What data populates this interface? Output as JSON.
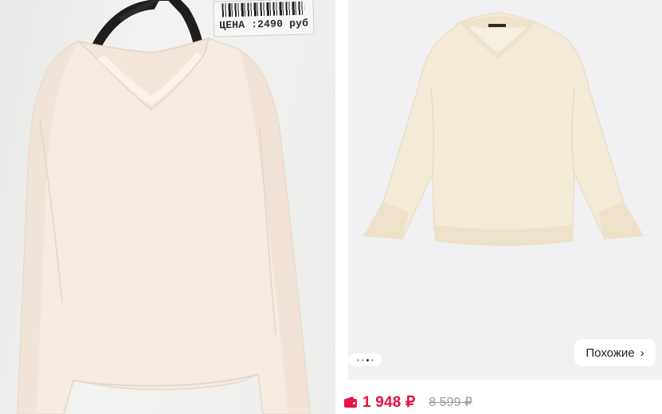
{
  "left_photo": {
    "price_tag_text": "ЦЕНА :2490 руб"
  },
  "product_card": {
    "carousel": {
      "total_dots": 4,
      "active_index": 2
    },
    "similar_button_label": "Похожие",
    "similar_chevron": "›"
  },
  "price": {
    "current": "1 948 ₽",
    "old": "8 599 ₽",
    "accent_color": "#e8133f",
    "icon": "wallet-icon"
  }
}
